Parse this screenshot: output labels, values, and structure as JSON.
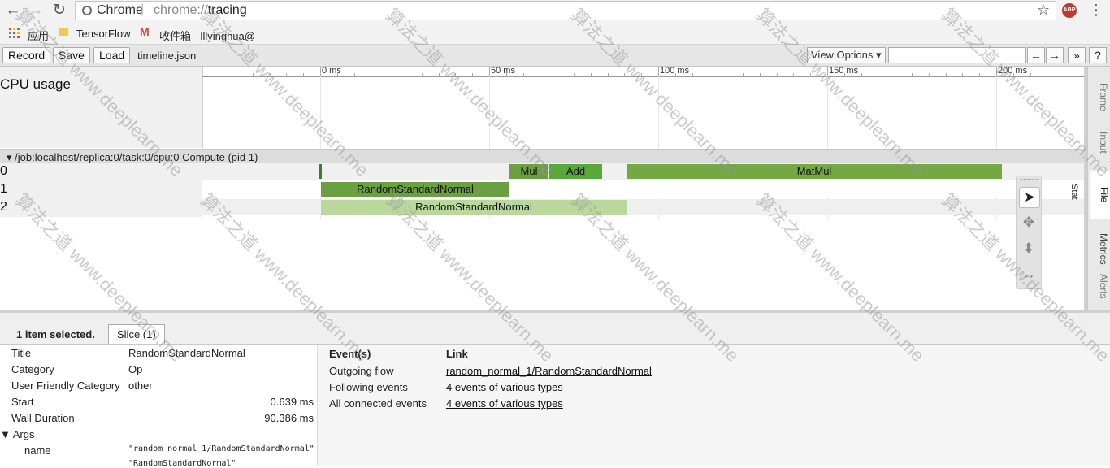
{
  "browser": {
    "host_label": "Chrome",
    "separator": "|",
    "url_scheme": "chrome://",
    "url_path": "tracing",
    "abp_label": "ABP",
    "bookmarks": [
      {
        "label": "应用"
      },
      {
        "label": "TensorFlow"
      },
      {
        "label": "收件箱 - lllyinghua@"
      }
    ]
  },
  "toolbar": {
    "record_label": "Record",
    "save_label": "Save",
    "load_label": "Load",
    "filename": "timeline.json",
    "view_options_label": "View Options ▾",
    "prev_label": "←",
    "next_label": "→",
    "more_label": "»",
    "help_label": "?"
  },
  "timeline": {
    "cpu_usage_label": "CPU usage",
    "ticks": [
      "0 ms",
      "50 ms",
      "100 ms",
      "150 ms",
      "200 ms"
    ],
    "process_header": "/job:localhost/replica:0/task:0/cpu:0 Compute (pid 1)",
    "rows": [
      {
        "label": "0",
        "slices": [
          {
            "name": "Mul"
          },
          {
            "name": "Add"
          },
          {
            "name": "MatMul"
          }
        ]
      },
      {
        "label": "1",
        "slices": [
          {
            "name": "RandomStandardNormal"
          }
        ]
      },
      {
        "label": "2",
        "slices": [
          {
            "name": "RandomStandardNormal"
          }
        ]
      }
    ],
    "stat_label": "Stat",
    "right_tabs": [
      "Frame",
      "Input",
      "File",
      "Metrics",
      "Alerts"
    ]
  },
  "selection": {
    "count_label": "1 item selected.",
    "tab_label": "Slice (1)",
    "fields": [
      {
        "key": "Title",
        "value": "RandomStandardNormal"
      },
      {
        "key": "Category",
        "value": "Op"
      },
      {
        "key": "User Friendly Category",
        "value": "other"
      },
      {
        "key": "Start",
        "value": "0.639 ms"
      },
      {
        "key": "Wall Duration",
        "value": "90.386 ms"
      }
    ],
    "args_label": "▼ Args",
    "arg_key": "name",
    "arg_value": "\"random_normal_1/RandomStandardNormal\"",
    "arg_value_2": "\"RandomStandardNormal\""
  },
  "events": {
    "col_events": "Event(s)",
    "col_link": "Link",
    "rows": [
      {
        "event": "Outgoing flow",
        "link": "random_normal_1/RandomStandardNormal"
      },
      {
        "event": "Following events",
        "link": "4 events of various types"
      },
      {
        "event": "All connected events",
        "link": "4 events of various types"
      }
    ]
  },
  "watermark": {
    "text_cn": "算法之道",
    "text_url": "www.deeplearn.me"
  }
}
